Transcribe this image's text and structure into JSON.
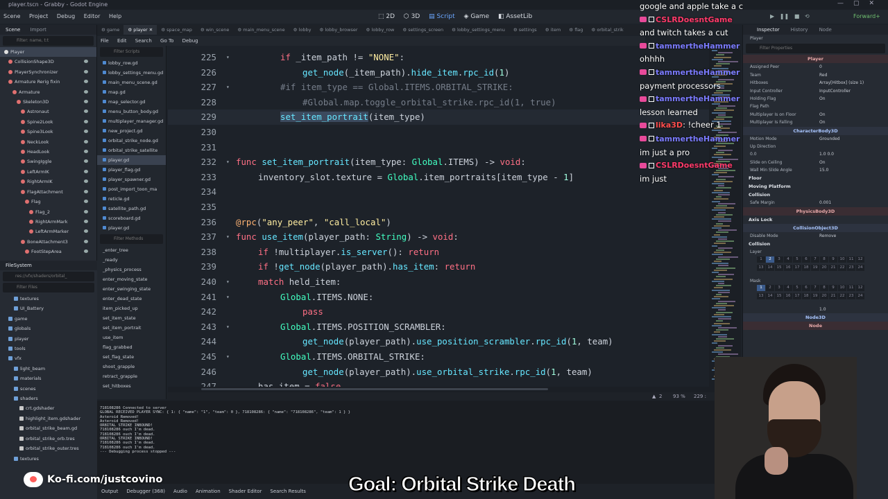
{
  "window": {
    "title": "player.tscn - Grabby - Godot Engine"
  },
  "menubar": {
    "items": [
      "Scene",
      "Project",
      "Debug",
      "Editor",
      "Help"
    ]
  },
  "workspaces": {
    "items": [
      "2D",
      "3D",
      "Script",
      "Game",
      "AssetLib"
    ],
    "active": "Script"
  },
  "renderer": "Forward+",
  "scene_dock": {
    "tabs": [
      "Scene",
      "Import"
    ],
    "filter_placeholder": "Filter: name, t:t",
    "nodes": [
      {
        "label": "Player",
        "depth": 0,
        "color": "#e0e0e0"
      },
      {
        "label": "CollisionShape3D",
        "depth": 1,
        "color": "#e07070"
      },
      {
        "label": "PlayerSynchronizer",
        "depth": 1,
        "color": "#e07070"
      },
      {
        "label": "Armature Rerig fixin",
        "depth": 1,
        "color": "#e07070"
      },
      {
        "label": "Armature",
        "depth": 2,
        "color": "#e07070"
      },
      {
        "label": "Skeleton3D",
        "depth": 3,
        "color": "#e07070"
      },
      {
        "label": "Astronaut",
        "depth": 4,
        "color": "#e07070"
      },
      {
        "label": "Spine2Look",
        "depth": 4,
        "color": "#e07070"
      },
      {
        "label": "Spine3Look",
        "depth": 4,
        "color": "#e07070"
      },
      {
        "label": "NeckLook",
        "depth": 4,
        "color": "#e07070"
      },
      {
        "label": "HeadLook",
        "depth": 4,
        "color": "#e07070"
      },
      {
        "label": "SwingIggle",
        "depth": 4,
        "color": "#e07070"
      },
      {
        "label": "LeftArmIK",
        "depth": 4,
        "color": "#e07070"
      },
      {
        "label": "RightArmIK",
        "depth": 4,
        "color": "#e07070"
      },
      {
        "label": "FlagAttachment",
        "depth": 4,
        "color": "#e07070"
      },
      {
        "label": "Flag",
        "depth": 5,
        "color": "#e07070"
      },
      {
        "label": "Flag_2",
        "depth": 6,
        "color": "#e07070"
      },
      {
        "label": "RightArmMark",
        "depth": 6,
        "color": "#e07070"
      },
      {
        "label": "LeftArmMarker",
        "depth": 6,
        "color": "#e07070"
      },
      {
        "label": "BoneAttachment3",
        "depth": 4,
        "color": "#e07070"
      },
      {
        "label": "FootStepArea",
        "depth": 5,
        "color": "#e07070"
      }
    ]
  },
  "filesystem": {
    "title": "FileSystem",
    "path": "res://vfx/shaders/orbital_",
    "filter_placeholder": "Filter Files",
    "items": [
      {
        "label": "textures",
        "depth": 2,
        "kind": "folder"
      },
      {
        "label": "UI_Battery",
        "depth": 2,
        "kind": "folder"
      },
      {
        "label": "game",
        "depth": 1,
        "kind": "folder"
      },
      {
        "label": "globals",
        "depth": 1,
        "kind": "folder"
      },
      {
        "label": "player",
        "depth": 1,
        "kind": "folder"
      },
      {
        "label": "tools",
        "depth": 1,
        "kind": "folder"
      },
      {
        "label": "vfx",
        "depth": 1,
        "kind": "folder"
      },
      {
        "label": "light_beam",
        "depth": 2,
        "kind": "folder"
      },
      {
        "label": "materials",
        "depth": 2,
        "kind": "folder"
      },
      {
        "label": "scenes",
        "depth": 2,
        "kind": "folder"
      },
      {
        "label": "shaders",
        "depth": 2,
        "kind": "folder"
      },
      {
        "label": "crt.gdshader",
        "depth": 3,
        "kind": "file"
      },
      {
        "label": "highlight_item.gdshader",
        "depth": 3,
        "kind": "file"
      },
      {
        "label": "orbital_strike_beam.gd",
        "depth": 3,
        "kind": "file"
      },
      {
        "label": "orbital_strike_orb.tres",
        "depth": 3,
        "kind": "file"
      },
      {
        "label": "orbital_strike_outer.tres",
        "depth": 3,
        "kind": "file"
      },
      {
        "label": "textures",
        "depth": 2,
        "kind": "folder"
      }
    ]
  },
  "script_tabs": [
    "game",
    "player",
    "space_map",
    "win_scene",
    "main_menu_scene",
    "lobby",
    "lobby_browser",
    "lobby_row",
    "settings_screen",
    "lobby_settings_menu",
    "settings",
    "item",
    "flag",
    "orbital_strik"
  ],
  "active_script_tab": "player",
  "script_menu": [
    "File",
    "Edit",
    "Search",
    "Go To",
    "Debug"
  ],
  "script_list": {
    "filter_placeholder": "Filter Scripts",
    "items": [
      "lobby_row.gd",
      "lobby_settings_menu.gd",
      "main_menu_scene.gd",
      "map.gd",
      "map_selector.gd",
      "menu_button_body.gd",
      "multiplayer_manager.gd",
      "new_project.gd",
      "orbital_strike_node.gd",
      "orbital_strike_satellite",
      "player.gd",
      "player_flag.gd",
      "player_spawner.gd",
      "post_import_toon_ma",
      "reticle.gd",
      "satellite_path.gd",
      "scoreboard.gd",
      "player.gd"
    ],
    "selected": 10,
    "methods_title": "Filter Methods",
    "methods": [
      "_enter_tree",
      "_ready",
      "_physics_process",
      "enter_moving_state",
      "enter_swinging_state",
      "enter_dead_state",
      "item_picked_up",
      "set_item_state",
      "set_item_portrait",
      "use_item",
      "flag_grabbed",
      "set_flag_state",
      "shoot_grapple",
      "retract_grapple",
      "set_hitboxes"
    ]
  },
  "code": {
    "current_line": 229,
    "lines": [
      {
        "n": "225",
        "fold": "▾",
        "ind": 2,
        "toks": [
          [
            "kw",
            "if "
          ],
          [
            "",
            "_item_path != "
          ],
          [
            "str",
            "\"NONE\""
          ],
          [
            "",
            ":"
          ]
        ]
      },
      {
        "n": "226",
        "fold": "",
        "ind": 3,
        "toks": [
          [
            "fn",
            "get_node"
          ],
          [
            "",
            "(_item_path)."
          ],
          [
            "fn",
            "hide_item"
          ],
          [
            "",
            "."
          ],
          [
            "fn",
            "rpc_id"
          ],
          [
            "",
            "("
          ],
          [
            "num",
            "1"
          ],
          [
            "",
            ")"
          ]
        ]
      },
      {
        "n": "227",
        "fold": "▾",
        "ind": 2,
        "toks": [
          [
            "cm",
            "#if item_type == Global.ITEMS.ORBITAL_STRIKE:"
          ]
        ]
      },
      {
        "n": "228",
        "fold": "",
        "ind": 3,
        "toks": [
          [
            "cm",
            "#Global.map.toggle_orbital_strike.rpc_id(1, true)"
          ]
        ]
      },
      {
        "n": "229",
        "fold": "",
        "ind": 2,
        "toks": [
          [
            "fn hl",
            "set_item_portrait"
          ],
          [
            "",
            "(item_type)"
          ]
        ]
      },
      {
        "n": "230",
        "fold": "",
        "ind": 0,
        "toks": []
      },
      {
        "n": "231",
        "fold": "",
        "ind": 0,
        "toks": []
      },
      {
        "n": "232",
        "fold": "▾",
        "ind": 0,
        "toks": [
          [
            "kw",
            "func "
          ],
          [
            "fn",
            "set_item_portrait"
          ],
          [
            "",
            "(item_type: "
          ],
          [
            "ty",
            "Global"
          ],
          [
            "",
            ".ITEMS) -> "
          ],
          [
            "kw",
            "void"
          ],
          [
            "",
            ":"
          ]
        ]
      },
      {
        "n": "233",
        "fold": "",
        "ind": 1,
        "toks": [
          [
            "",
            "inventory_slot.texture = "
          ],
          [
            "ty",
            "Global"
          ],
          [
            "",
            ".item_portraits[item_type - "
          ],
          [
            "num",
            "1"
          ],
          [
            "",
            "]"
          ]
        ]
      },
      {
        "n": "234",
        "fold": "",
        "ind": 0,
        "toks": []
      },
      {
        "n": "235",
        "fold": "",
        "ind": 0,
        "toks": []
      },
      {
        "n": "236",
        "fold": "",
        "ind": 0,
        "toks": [
          [
            "an",
            "@rpc"
          ],
          [
            "",
            "("
          ],
          [
            "str",
            "\"any_peer\""
          ],
          [
            "",
            ", "
          ],
          [
            "str",
            "\"call_local\""
          ],
          [
            "",
            ")"
          ]
        ]
      },
      {
        "n": "237",
        "fold": "▾",
        "ind": 0,
        "toks": [
          [
            "kw",
            "func "
          ],
          [
            "fn",
            "use_item"
          ],
          [
            "",
            "(player_path: "
          ],
          [
            "ty",
            "String"
          ],
          [
            "",
            ") -> "
          ],
          [
            "kw",
            "void"
          ],
          [
            "",
            ":"
          ]
        ]
      },
      {
        "n": "238",
        "fold": "",
        "ind": 1,
        "toks": [
          [
            "kw",
            "if "
          ],
          [
            "",
            "!multiplayer."
          ],
          [
            "fn",
            "is_server"
          ],
          [
            "",
            "(): "
          ],
          [
            "kw",
            "return"
          ]
        ]
      },
      {
        "n": "239",
        "fold": "",
        "ind": 1,
        "toks": [
          [
            "kw",
            "if "
          ],
          [
            "",
            "!"
          ],
          [
            "fn",
            "get_node"
          ],
          [
            "",
            "(player_path)."
          ],
          [
            "fn",
            "has_item"
          ],
          [
            "",
            ": "
          ],
          [
            "kw",
            "return"
          ]
        ]
      },
      {
        "n": "240",
        "fold": "▾",
        "ind": 1,
        "toks": [
          [
            "kw",
            "match "
          ],
          [
            "",
            "held_item:"
          ]
        ]
      },
      {
        "n": "241",
        "fold": "▾",
        "ind": 2,
        "toks": [
          [
            "ty",
            "Global"
          ],
          [
            "",
            ".ITEMS.NONE:"
          ]
        ]
      },
      {
        "n": "242",
        "fold": "",
        "ind": 3,
        "toks": [
          [
            "kw",
            "pass"
          ]
        ]
      },
      {
        "n": "243",
        "fold": "▾",
        "ind": 2,
        "toks": [
          [
            "ty",
            "Global"
          ],
          [
            "",
            ".ITEMS.POSITION_SCRAMBLER:"
          ]
        ]
      },
      {
        "n": "244",
        "fold": "",
        "ind": 3,
        "toks": [
          [
            "fn",
            "get_node"
          ],
          [
            "",
            "(player_path)."
          ],
          [
            "fn",
            "use_position_scrambler"
          ],
          [
            "",
            "."
          ],
          [
            "fn",
            "rpc_id"
          ],
          [
            "",
            "("
          ],
          [
            "num",
            "1"
          ],
          [
            "",
            ", team)"
          ]
        ]
      },
      {
        "n": "245",
        "fold": "▾",
        "ind": 2,
        "toks": [
          [
            "ty",
            "Global"
          ],
          [
            "",
            ".ITEMS.ORBITAL_STRIKE:"
          ]
        ]
      },
      {
        "n": "246",
        "fold": "",
        "ind": 3,
        "toks": [
          [
            "fn",
            "get_node"
          ],
          [
            "",
            "(player_path)."
          ],
          [
            "fn",
            "use_orbital_strike"
          ],
          [
            "",
            "."
          ],
          [
            "fn",
            "rpc_id"
          ],
          [
            "",
            "("
          ],
          [
            "num",
            "1"
          ],
          [
            "",
            ", team)"
          ]
        ]
      },
      {
        "n": "247",
        "fold": "",
        "ind": 1,
        "toks": [
          [
            "",
            "has_item = "
          ],
          [
            "kw",
            "false"
          ]
        ]
      }
    ]
  },
  "status": {
    "warnings": "2",
    "zoom": "93 %",
    "position": "229 :"
  },
  "output": {
    "lines": [
      "718108286 Connected to server",
      "GLOBAL RECEIVED PLAYER SYNC: { 1: { \"name\": \"1\", \"team\": 0 }, 718108286: { \"name\": \"718108286\", \"team\": 1 } }",
      "Asteroid Removed!",
      "Asteroid Removed!",
      "ORBITAL STRIKE INBOUND!",
      "718108286 ouch I'm dead.",
      "718108286 ouch I'm dead.",
      "ORBITAL STRIKE INBOUND!",
      "718108286 ouch I'm dead.",
      "718108286 ouch I'm dead.",
      "--- Debugging process stopped ---"
    ]
  },
  "bottom_tabs": [
    "Output",
    "Debugger (368)",
    "Audio",
    "Animation",
    "Shader Editor",
    "Search Results"
  ],
  "inspector": {
    "tabs": [
      "Inspector",
      "History",
      "Node"
    ],
    "node_name": "Player",
    "filter_placeholder": "Filter Properties",
    "class_header": "Player",
    "rows": [
      {
        "k": "Assigned Peer",
        "v": "0"
      },
      {
        "k": "Team",
        "v": "Red"
      },
      {
        "k": "Hitboxes",
        "v": "Array[Hitbox] (size 1)"
      },
      {
        "k": "Input Controller",
        "v": "InputController"
      },
      {
        "k": "Holding Flag",
        "v": "On"
      },
      {
        "k": "Flag Path",
        "v": ""
      },
      {
        "k": "Multiplayer Is on Floor",
        "v": "On"
      },
      {
        "k": "Multiplayer Is Falling",
        "v": "On"
      }
    ],
    "section2": "CharacterBody3D",
    "rows2": [
      {
        "k": "Motion Mode",
        "v": "Grounded"
      },
      {
        "k": "Up Direction",
        "v": ""
      },
      {
        "k": "0.0",
        "v": "1.0     0.0"
      },
      {
        "k": "Slide on Ceiling",
        "v": "On"
      },
      {
        "k": "Wall Min Slide Angle",
        "v": "15.0"
      }
    ],
    "groups": [
      "Floor",
      "Moving Platform",
      "Collision"
    ],
    "safe_margin": {
      "k": "Safe Margin",
      "v": "0.001"
    },
    "section3": "PhysicsBody3D",
    "axis_lock": "Axis Lock",
    "section4": "CollisionObject3D",
    "disable_mode": {
      "k": "Disable Mode",
      "v": "Remove"
    },
    "collision_group": "Collision",
    "layer_label": "Layer",
    "mask_label": "Mask",
    "priority": "1.0",
    "section5": "Node3D",
    "section6": "Node"
  },
  "chat": [
    {
      "type": "msg",
      "text": "google and apple take a cut"
    },
    {
      "type": "user",
      "name": "CSLRDoesntGame",
      "color": "#ff3a6a"
    },
    {
      "type": "msg",
      "text": "and twitch takes a cut"
    },
    {
      "type": "user",
      "name": "tammertheHammer",
      "color": "#7b7bff"
    },
    {
      "type": "msg",
      "text": "ohhhh"
    },
    {
      "type": "user",
      "name": "tammertheHammer",
      "color": "#7b7bff"
    },
    {
      "type": "msg",
      "text": "payment processors"
    },
    {
      "type": "user",
      "name": "tammertheHammer",
      "color": "#7b7bff"
    },
    {
      "type": "msg",
      "text": "lesson learned"
    },
    {
      "type": "user",
      "name": "lika3D",
      "color": "#ff4d4d",
      "extra": ": !cheer 1"
    },
    {
      "type": "user",
      "name": "tammertheHammer",
      "color": "#7b7bff"
    },
    {
      "type": "msg",
      "text": "im just a pro"
    },
    {
      "type": "user",
      "name": "CSLRDoesntGame",
      "color": "#ff3a6a"
    },
    {
      "type": "msg",
      "text": "im just"
    }
  ],
  "kofi": "Ko-fi.com/justcovino",
  "goal": "Goal: Orbital Strike Death"
}
